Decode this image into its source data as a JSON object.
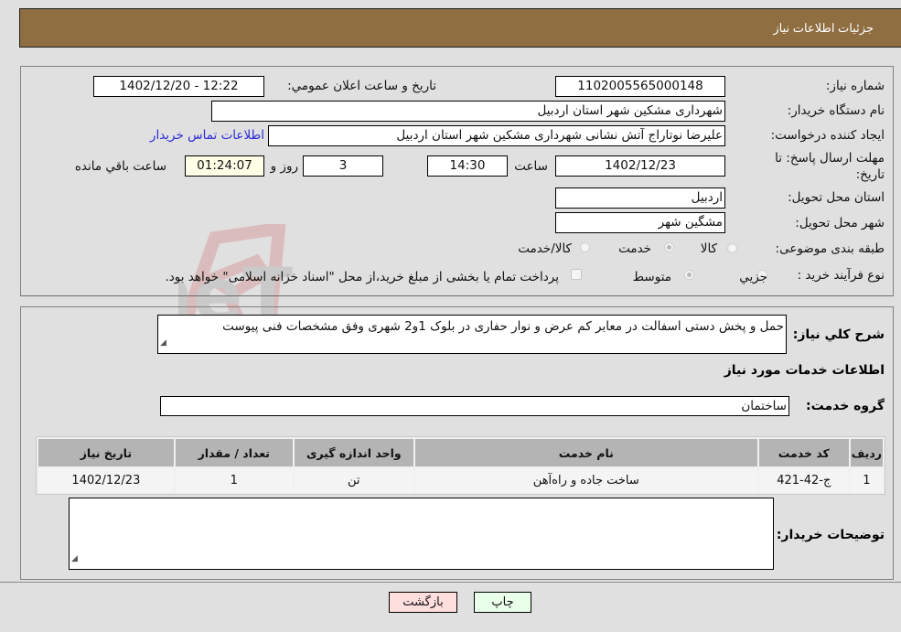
{
  "header": {
    "title": "جزئیات اطلاعات نیاز"
  },
  "fields": {
    "need_number": {
      "label": "شماره نیاز:",
      "value": "1102005565000148"
    },
    "announce_datetime": {
      "label": "تاريخ و ساعت اعلان عمومي:",
      "value": "1402/12/20 - 12:22"
    },
    "buyer_org": {
      "label": "نام دستگاه خریدار:",
      "value": "شهرداری مشکین شهر استان اردبیل"
    },
    "requester": {
      "label": "ایجاد کننده درخواست:",
      "value": "علیرضا نوتاراج آتش نشانی شهرداری مشکین شهر استان اردبیل"
    },
    "buyer_contact_link": "اطلاعات تماس خریدار",
    "deadline": {
      "label": "مهلت ارسال پاسخ: تا تاریخ:",
      "date": "1402/12/23",
      "time_label": "ساعت",
      "time": "14:30",
      "days": "3",
      "days_label": "روز و",
      "remaining": "01:24:07",
      "remaining_label": "ساعت باقي مانده"
    },
    "province": {
      "label": "استان محل تحویل:",
      "value": "اردبیل"
    },
    "city": {
      "label": "شهر محل تحویل:",
      "value": "مشگین شهر"
    },
    "category": {
      "label": "طبقه بندی موضوعی:",
      "options": [
        "کالا",
        "خدمت",
        "کالا/خدمت"
      ],
      "selected": "خدمت"
    },
    "purchase_type": {
      "label": "نوع فرآیند خرید :",
      "options": [
        "جزيي",
        "متوسط"
      ],
      "selected": "متوسط",
      "treasury_note": "پرداخت تمام یا بخشی از مبلغ خرید،از محل \"اسناد خزانه اسلامی\" خواهد بود."
    }
  },
  "description": {
    "label": "شرح کلي نياز:",
    "value": "حمل و پخش دستی اسفالت در معابر کم عرض و نوار حفاری در بلوک 1و2 شهری وفق مشخصات فنی پیوست"
  },
  "services_section": {
    "title": "اطلاعات خدمات مورد نیاز"
  },
  "service_group": {
    "label": "گروه خدمت:",
    "value": "ساختمان"
  },
  "table": {
    "headers": [
      "ردیف",
      "کد خدمت",
      "نام خدمت",
      "واحد اندازه گیری",
      "تعداد / مقدار",
      "تاریخ نیاز"
    ],
    "rows": [
      [
        "1",
        "ج-42-421",
        "ساخت جاده و راه‌آهن",
        "تن",
        "1",
        "1402/12/23"
      ]
    ]
  },
  "buyer_notes": {
    "label": "توضیحات خریدار:",
    "value": ""
  },
  "buttons": {
    "print": "چاپ",
    "back": "بازگشت"
  },
  "colors": {
    "header_bg": "#8f6e42",
    "link": "#2a2ad8",
    "print_bg": "#eaffea",
    "back_bg": "#ffdede"
  },
  "watermark": "AriaTender.neT"
}
